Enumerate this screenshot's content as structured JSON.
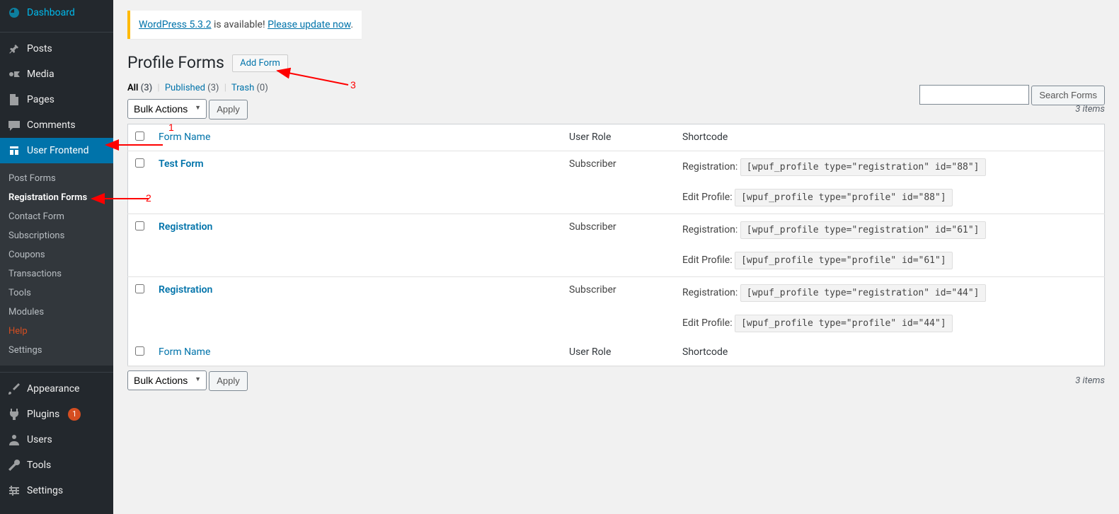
{
  "sidebar": {
    "items": [
      {
        "label": "Dashboard",
        "icon": "dashboard"
      },
      {
        "label": "Posts",
        "icon": "pin"
      },
      {
        "label": "Media",
        "icon": "media"
      },
      {
        "label": "Pages",
        "icon": "pages"
      },
      {
        "label": "Comments",
        "icon": "comment"
      },
      {
        "label": "User Frontend",
        "icon": "frontend",
        "active": true
      },
      {
        "label": "Appearance",
        "icon": "brush"
      },
      {
        "label": "Plugins",
        "icon": "plug",
        "badge": "1"
      },
      {
        "label": "Users",
        "icon": "users"
      },
      {
        "label": "Tools",
        "icon": "wrench"
      },
      {
        "label": "Settings",
        "icon": "settings"
      }
    ],
    "submenu": [
      {
        "label": "Post Forms"
      },
      {
        "label": "Registration Forms",
        "current": true
      },
      {
        "label": "Contact Form"
      },
      {
        "label": "Subscriptions"
      },
      {
        "label": "Coupons"
      },
      {
        "label": "Transactions"
      },
      {
        "label": "Tools"
      },
      {
        "label": "Modules"
      },
      {
        "label": "Help",
        "help": true
      },
      {
        "label": "Settings"
      }
    ]
  },
  "notice": {
    "prefix_link": "WordPress 5.3.2",
    "mid": " is available! ",
    "action_link": "Please update now",
    "suffix": "."
  },
  "page": {
    "title": "Profile Forms",
    "action": "Add Form"
  },
  "filters": {
    "all_label": "All",
    "all_count": "(3)",
    "published_label": "Published",
    "published_count": "(3)",
    "trash_label": "Trash",
    "trash_count": "(0)"
  },
  "bulk": {
    "label": "Bulk Actions",
    "apply": "Apply"
  },
  "search": {
    "button": "Search Forms"
  },
  "count": "3 items",
  "table": {
    "headers": {
      "name": "Form Name",
      "role": "User Role",
      "code": "Shortcode"
    },
    "rows": [
      {
        "name": "Test Form",
        "role": "Subscriber",
        "codes": [
          {
            "label": "Registration:",
            "code": "[wpuf_profile type=\"registration\" id=\"88\"]"
          },
          {
            "label": "Edit Profile:",
            "code": "[wpuf_profile type=\"profile\" id=\"88\"]"
          }
        ]
      },
      {
        "name": "Registration",
        "role": "Subscriber",
        "codes": [
          {
            "label": "Registration:",
            "code": "[wpuf_profile type=\"registration\" id=\"61\"]"
          },
          {
            "label": "Edit Profile:",
            "code": "[wpuf_profile type=\"profile\" id=\"61\"]"
          }
        ]
      },
      {
        "name": "Registration",
        "role": "Subscriber",
        "codes": [
          {
            "label": "Registration:",
            "code": "[wpuf_profile type=\"registration\" id=\"44\"]"
          },
          {
            "label": "Edit Profile:",
            "code": "[wpuf_profile type=\"profile\" id=\"44\"]"
          }
        ]
      }
    ]
  },
  "annotations": {
    "n1": "1",
    "n2": "2",
    "n3": "3"
  }
}
